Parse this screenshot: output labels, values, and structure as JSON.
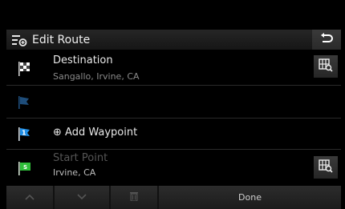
{
  "header": {
    "title": "Edit Route",
    "icon": "edit-route-icon",
    "back_icon": "back-arrow-icon"
  },
  "route": {
    "destination": {
      "name": "Destination",
      "address": "Sangallo, Irvine, CA",
      "flag_icon": "checkered-flag-icon",
      "map_icon": "map-search-icon"
    },
    "waypoint_empty": {
      "flag_icon": "dim-flag-icon"
    },
    "add_waypoint": {
      "label": "⊕ Add Waypoint",
      "flag_icon": "waypoint-flag-1-icon",
      "flag_number": "1"
    },
    "start": {
      "name": "Start Point",
      "address": "Irvine, CA",
      "flag_icon": "start-flag-icon",
      "flag_letter": "S",
      "map_icon": "map-search-icon"
    }
  },
  "toolbar": {
    "up_icon": "chevron-up-icon",
    "down_icon": "chevron-down-icon",
    "delete_icon": "trash-icon",
    "done_label": "Done"
  },
  "colors": {
    "blue_flag": "#1f8fe8",
    "green_flag": "#2fbf3a",
    "dim_flag": "#1e4d7a"
  }
}
